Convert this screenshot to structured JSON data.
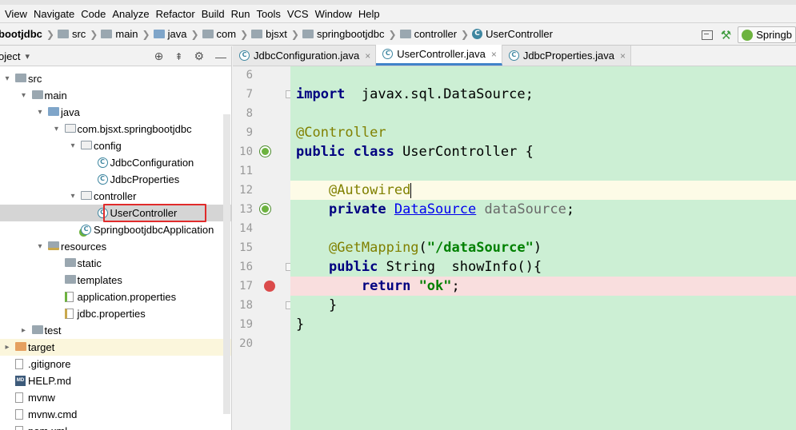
{
  "menu": [
    "View",
    "Navigate",
    "Code",
    "Analyze",
    "Refactor",
    "Build",
    "Run",
    "Tools",
    "VCS",
    "Window",
    "Help"
  ],
  "breadcrumb": [
    "bootjdbc",
    "src",
    "main",
    "java",
    "com",
    "bjsxt",
    "springbootjdbc",
    "controller",
    "UserController"
  ],
  "run_config": "Springb",
  "project_panel": {
    "title": "oject",
    "dropdown": "▾"
  },
  "tree": [
    {
      "label": "src",
      "depth": 0,
      "arrow": "▾",
      "icon": "folder"
    },
    {
      "label": "main",
      "depth": 1,
      "arrow": "▾",
      "icon": "folder"
    },
    {
      "label": "java",
      "depth": 2,
      "arrow": "▾",
      "icon": "folder-blue"
    },
    {
      "label": "com.bjsxt.springbootjdbc",
      "depth": 3,
      "arrow": "▾",
      "icon": "package"
    },
    {
      "label": "config",
      "depth": 4,
      "arrow": "▾",
      "icon": "package"
    },
    {
      "label": "JdbcConfiguration",
      "depth": 5,
      "arrow": "",
      "icon": "class"
    },
    {
      "label": "JdbcProperties",
      "depth": 5,
      "arrow": "",
      "icon": "class"
    },
    {
      "label": "controller",
      "depth": 4,
      "arrow": "▾",
      "icon": "package"
    },
    {
      "label": "UserController",
      "depth": 5,
      "arrow": "",
      "icon": "class",
      "selected": true
    },
    {
      "label": "SpringbootjdbcApplication",
      "depth": 4,
      "arrow": "",
      "icon": "class-boot"
    },
    {
      "label": "resources",
      "depth": 2,
      "arrow": "▾",
      "icon": "folder-res"
    },
    {
      "label": "static",
      "depth": 3,
      "arrow": "",
      "icon": "folder"
    },
    {
      "label": "templates",
      "depth": 3,
      "arrow": "",
      "icon": "folder"
    },
    {
      "label": "application.properties",
      "depth": 3,
      "arrow": "",
      "icon": "props-leaf"
    },
    {
      "label": "jdbc.properties",
      "depth": 3,
      "arrow": "",
      "icon": "props"
    },
    {
      "label": "test",
      "depth": 1,
      "arrow": "▸",
      "icon": "folder"
    },
    {
      "label": "target",
      "depth": 0,
      "arrow": "▸",
      "icon": "folder-orange",
      "excluded": true
    },
    {
      "label": ".gitignore",
      "depth": 0,
      "arrow": "",
      "icon": "file"
    },
    {
      "label": "HELP.md",
      "depth": 0,
      "arrow": "",
      "icon": "md"
    },
    {
      "label": "mvnw",
      "depth": 0,
      "arrow": "",
      "icon": "file"
    },
    {
      "label": "mvnw.cmd",
      "depth": 0,
      "arrow": "",
      "icon": "file"
    },
    {
      "label": "pom.xml",
      "depth": 0,
      "arrow": "",
      "icon": "file"
    }
  ],
  "tabs": [
    {
      "label": "JdbcConfiguration.java",
      "active": false
    },
    {
      "label": "UserController.java",
      "active": true
    },
    {
      "label": "JdbcProperties.java",
      "active": false
    }
  ],
  "line_numbers": [
    "6",
    "7",
    "8",
    "9",
    "10",
    "11",
    "12",
    "13",
    "14",
    "15",
    "16",
    "17",
    "18",
    "19",
    "20"
  ],
  "code": [
    {
      "line": "6",
      "tokens": []
    },
    {
      "line": "7",
      "tokens": [
        [
          "kw",
          "import"
        ],
        [
          "",
          "  javax.sql.DataSource;"
        ]
      ]
    },
    {
      "line": "8",
      "tokens": []
    },
    {
      "line": "9",
      "tokens": [
        [
          "ann",
          "@Controller"
        ]
      ]
    },
    {
      "line": "10",
      "tokens": [
        [
          "kw",
          "public class"
        ],
        [
          "",
          " UserController {"
        ]
      ]
    },
    {
      "line": "11",
      "tokens": []
    },
    {
      "line": "12",
      "tokens": [
        [
          "",
          "    "
        ],
        [
          "ann",
          "@Autowired"
        ]
      ]
    },
    {
      "line": "13",
      "tokens": [
        [
          "",
          "    "
        ],
        [
          "kw",
          "private"
        ],
        [
          "",
          " "
        ],
        [
          "lnk",
          "DataSource"
        ],
        [
          "",
          " "
        ],
        [
          "fld",
          "dataSource"
        ],
        [
          "",
          ";"
        ]
      ]
    },
    {
      "line": "14",
      "tokens": []
    },
    {
      "line": "15",
      "tokens": [
        [
          "",
          "    "
        ],
        [
          "ann",
          "@GetMapping"
        ],
        [
          "",
          "("
        ],
        [
          "str",
          "\"/dataSource\""
        ],
        [
          "",
          ")"
        ]
      ]
    },
    {
      "line": "16",
      "tokens": [
        [
          "",
          "    "
        ],
        [
          "kw",
          "public"
        ],
        [
          "",
          " String  showInfo(){"
        ]
      ]
    },
    {
      "line": "17",
      "tokens": [
        [
          "",
          "        "
        ],
        [
          "kw",
          "return"
        ],
        [
          "",
          " "
        ],
        [
          "str",
          "\"ok\""
        ],
        [
          "",
          ";"
        ]
      ]
    },
    {
      "line": "18",
      "tokens": [
        [
          "",
          "    }"
        ]
      ]
    },
    {
      "line": "19",
      "tokens": [
        [
          "",
          "}"
        ]
      ]
    },
    {
      "line": "20",
      "tokens": []
    }
  ],
  "colors": {
    "code_bg": "#ccefd4",
    "current_line": "#fdfbe7",
    "breakpoint_line": "#f9dede",
    "breakpoint": "#db4b4b",
    "selection_box": "#e02b2b"
  }
}
